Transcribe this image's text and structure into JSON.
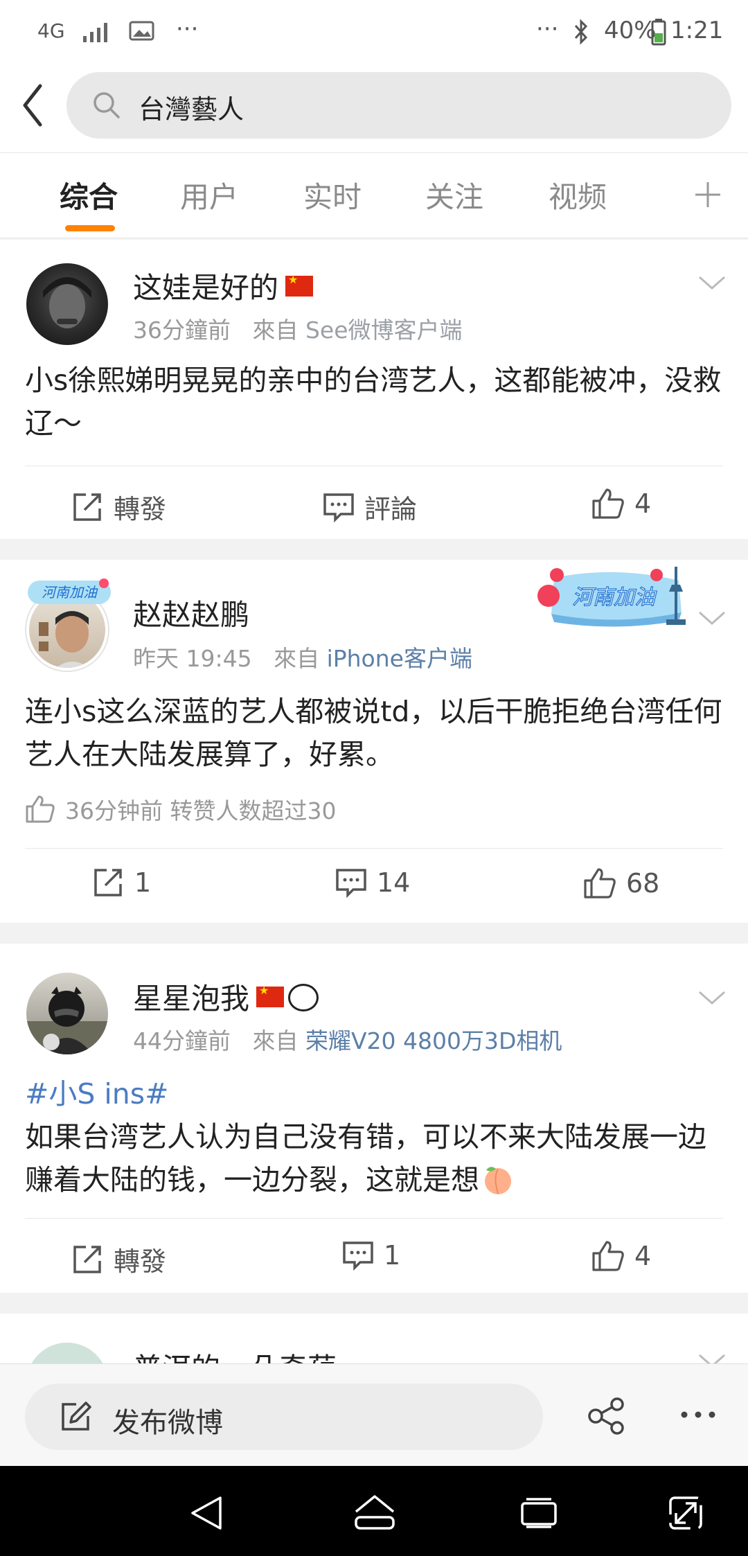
{
  "status_bar": {
    "network": "4G",
    "dots": "···",
    "battery": "40%",
    "time": "1:21"
  },
  "search": {
    "query": "台灣藝人"
  },
  "tabs": [
    {
      "label": "综合",
      "active": true
    },
    {
      "label": "用户"
    },
    {
      "label": "实时"
    },
    {
      "label": "关注"
    },
    {
      "label": "视频"
    }
  ],
  "posts": [
    {
      "username": "这娃是好的",
      "time": "36分鐘前",
      "from_label": "來自",
      "source": "See微博客户端",
      "text": "小s徐熙娣明晃晃的亲中的台湾艺人，这都能被冲，没救辽～",
      "actions": {
        "repost": "轉發",
        "comment": "評論",
        "like": "4"
      }
    },
    {
      "username": "赵赵赵鹏",
      "time": "昨天 19:45",
      "from_label": "來自",
      "source": "iPhone客户端",
      "badge": "河南加油",
      "text": "连小s这么深蓝的艺人都被说td，以后干脆拒绝台湾任何艺人在大陆发展算了，好累。",
      "like_info": "36分钟前 转赞人数超过30",
      "actions": {
        "repost": "1",
        "comment": "14",
        "like": "68"
      }
    },
    {
      "username": "星星泡我",
      "time": "44分鐘前",
      "from_label": "來自",
      "source": "荣耀V20 4800万3D相机",
      "topic": "#小S ins#",
      "text": "如果台湾艺人认为自己没有错，可以不来大陆发展一边赚着大陆的钱，一边分裂，这就是想",
      "actions": {
        "repost": "轉發",
        "comment": "1",
        "like": "4"
      }
    },
    {
      "username": "普洱的一朵奇葩"
    }
  ],
  "compose": {
    "label": "发布微博"
  }
}
